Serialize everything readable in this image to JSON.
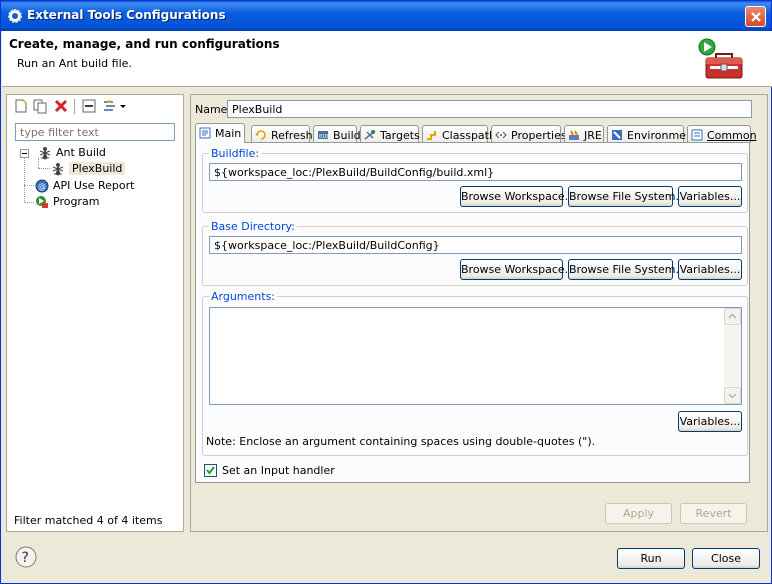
{
  "window": {
    "title": "External Tools Configurations"
  },
  "banner": {
    "title": "Create, manage, and run configurations",
    "subtitle": "Run an Ant build file."
  },
  "left": {
    "filter_placeholder": "type filter text",
    "tree": [
      {
        "label": "Ant Build",
        "icon": "ant-icon",
        "expanded": true
      },
      {
        "label": "PlexBuild",
        "icon": "ant-icon",
        "selected": true
      },
      {
        "label": "API Use Report",
        "icon": "api-report-icon"
      },
      {
        "label": "Program",
        "icon": "program-icon"
      }
    ],
    "status": "Filter matched 4 of 4 items"
  },
  "config": {
    "name_label": "Name:",
    "name_value": "PlexBuild",
    "tabs": [
      {
        "label": "Main",
        "icon": "main-tab-icon",
        "active": true
      },
      {
        "label": "Refresh",
        "icon": "refresh-icon"
      },
      {
        "label": "Build",
        "icon": "build-icon"
      },
      {
        "label": "Targets",
        "icon": "targets-icon"
      },
      {
        "label": "Classpath",
        "icon": "classpath-icon"
      },
      {
        "label": "Properties",
        "icon": "properties-icon"
      },
      {
        "label": "JRE",
        "icon": "jre-icon"
      },
      {
        "label": "Environment",
        "icon": "environment-icon"
      },
      {
        "label": "Common",
        "icon": "common-icon"
      }
    ],
    "buildfile": {
      "title": "Buildfile:",
      "value": "${workspace_loc:/PlexBuild/BuildConfig/build.xml}",
      "buttons": [
        "Browse Workspace...",
        "Browse File System...",
        "Variables..."
      ]
    },
    "basedir": {
      "title": "Base Directory:",
      "value": "${workspace_loc:/PlexBuild/BuildConfig}",
      "buttons": [
        "Browse Workspace...",
        "Browse File System...",
        "Variables..."
      ]
    },
    "arguments": {
      "title": "Arguments:",
      "value": "",
      "variables_button": "Variables...",
      "note": "Note: Enclose an argument containing spaces using double-quotes (\")."
    },
    "input_handler": {
      "label": "Set an Input handler",
      "checked": true
    },
    "apply_button": "Apply",
    "revert_button": "Revert"
  },
  "footer": {
    "run_button": "Run",
    "close_button": "Close"
  },
  "colors": {
    "title_bar": "#0553d6",
    "group_title": "#0046d5"
  }
}
